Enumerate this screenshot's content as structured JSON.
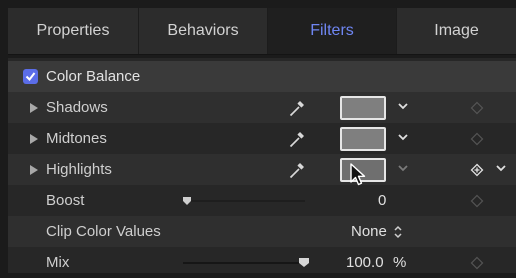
{
  "tabs": [
    "Properties",
    "Behaviors",
    "Filters",
    "Image"
  ],
  "filter": {
    "name": "Color Balance",
    "enabled": true,
    "rows": [
      {
        "label": "Shadows"
      },
      {
        "label": "Midtones"
      },
      {
        "label": "Highlights"
      }
    ],
    "boost": {
      "label": "Boost",
      "value": "0",
      "fraction": 0
    },
    "clip": {
      "label": "Clip Color Values",
      "value": "None"
    },
    "mix": {
      "label": "Mix",
      "value": "100.0",
      "unit": "%",
      "fraction": 1.0
    }
  },
  "colors": {
    "accent": "#6f86f2",
    "checkbox": "#5b6de8",
    "swatch": "#7f7f7f"
  }
}
